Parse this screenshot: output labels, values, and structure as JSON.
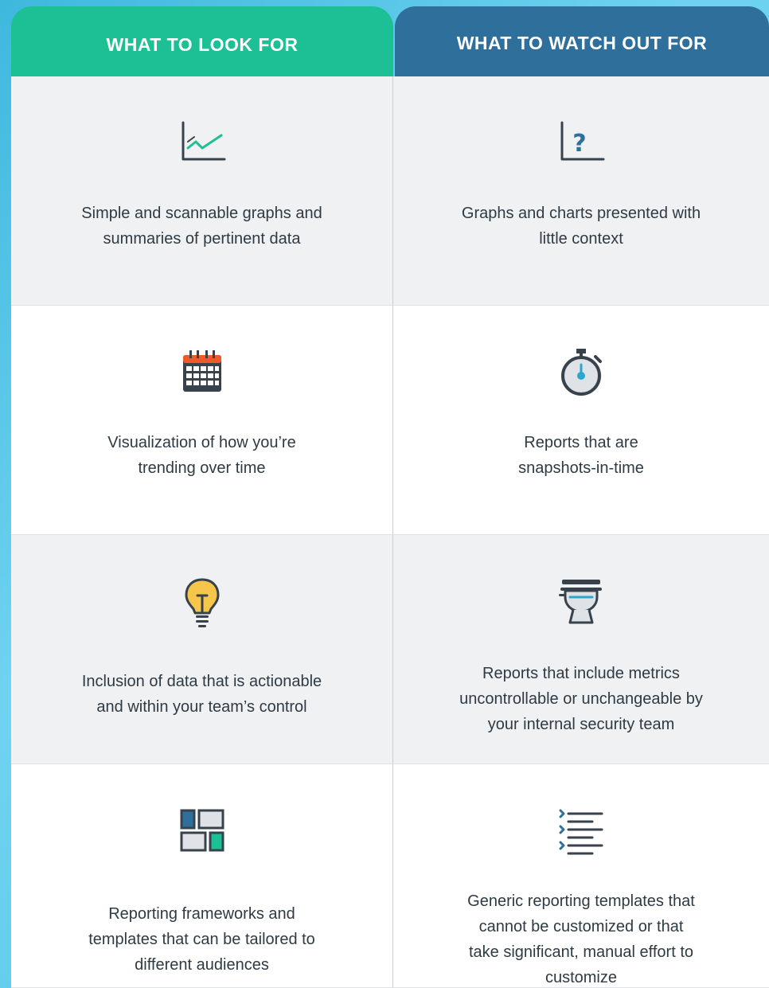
{
  "headers": {
    "left": "WHAT TO LOOK FOR",
    "right": "WHAT TO WATCH OUT FOR"
  },
  "colors": {
    "left_header": "#1dbf95",
    "right_header": "#2f6f9b",
    "row_grey": "#f0f1f3",
    "row_white": "#ffffff",
    "accent_orange": "#f05a28",
    "accent_yellow": "#f6c64a",
    "accent_teal": "#1dbf95",
    "accent_blue": "#2f6f9b"
  },
  "rows": [
    {
      "left": {
        "icon": "line-chart-icon",
        "text_lines": [
          "Simple and scannable graphs and",
          "summaries of pertinent data"
        ]
      },
      "right": {
        "icon": "chart-question-icon",
        "text_lines": [
          "Graphs and charts presented with",
          "little context"
        ]
      }
    },
    {
      "left": {
        "icon": "calendar-icon",
        "text_lines": [
          "Visualization of how you’re",
          "trending over time"
        ]
      },
      "right": {
        "icon": "stopwatch-icon",
        "text_lines": [
          "Reports that are",
          "snapshots-in-time"
        ]
      }
    },
    {
      "left": {
        "icon": "lightbulb-icon",
        "text_lines": [
          "Inclusion of data that is actionable",
          "and within your team’s control"
        ]
      },
      "right": {
        "icon": "toilet-icon",
        "text_lines": [
          "Reports that include metrics",
          "uncontrollable or unchangeable by",
          "your internal security team"
        ]
      }
    },
    {
      "left": {
        "icon": "layout-grid-icon",
        "text_lines": [
          "Reporting frameworks and",
          "templates that can be tailored to",
          "different audiences"
        ]
      },
      "right": {
        "icon": "list-icon",
        "text_lines": [
          "Generic reporting templates that",
          "cannot be customized or that",
          "take significant, manual effort to",
          "customize"
        ]
      }
    }
  ]
}
